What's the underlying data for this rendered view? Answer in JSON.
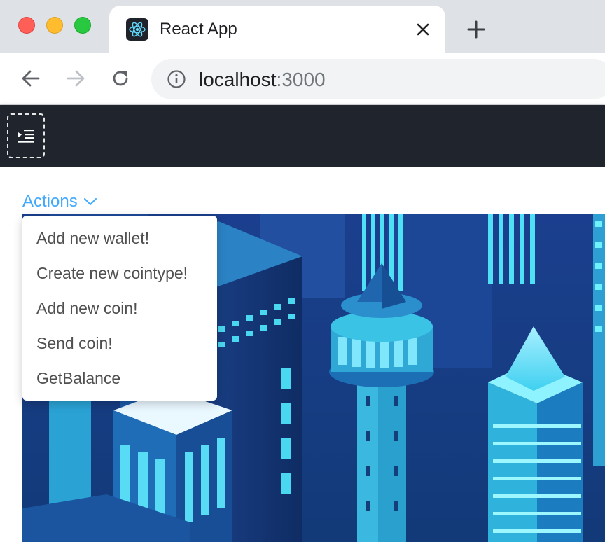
{
  "browser": {
    "tab": {
      "title": "React App",
      "favicon": "react-logo-icon",
      "close_icon": "close-icon"
    },
    "new_tab_icon": "plus-icon",
    "nav": {
      "back_icon": "arrow-left-icon",
      "forward_icon": "arrow-right-icon",
      "reload_icon": "reload-icon"
    },
    "address": {
      "info_icon": "info-icon",
      "host": "localhost",
      "port": ":3000"
    }
  },
  "app": {
    "header": {
      "menu_toggle_icon": "menu-indent-icon",
      "background": "#20242d"
    },
    "actions": {
      "label": "Actions",
      "icon": "chevron-down-icon",
      "accent": "#40a9ff",
      "items": [
        {
          "label": "Add new wallet!"
        },
        {
          "label": "Create new cointype!"
        },
        {
          "label": "Add new coin!"
        },
        {
          "label": "Send coin!"
        },
        {
          "label": "GetBalance"
        }
      ]
    },
    "hero": {
      "description_icon": "isometric-city-illustration"
    }
  }
}
